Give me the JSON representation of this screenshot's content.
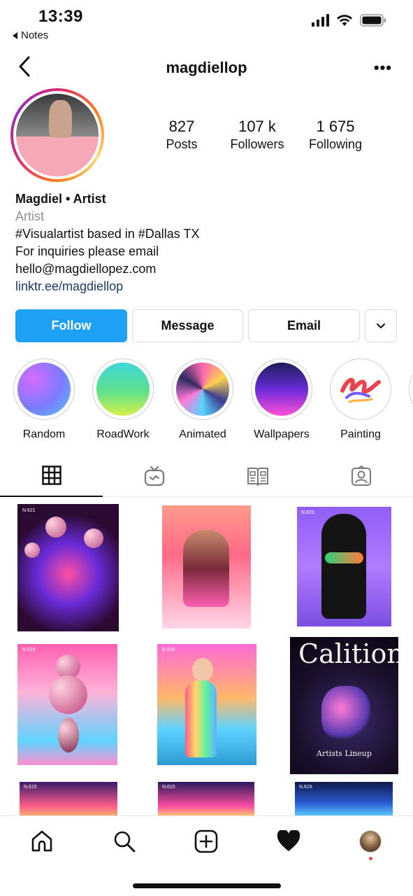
{
  "status_bar": {
    "time": "13:39",
    "back_app": "Notes",
    "icons": [
      "cellular-signal-icon",
      "wifi-icon",
      "battery-icon"
    ]
  },
  "header": {
    "username": "magdiellop",
    "back_icon": "chevron-left-icon",
    "more_icon": "more-horizontal-icon",
    "more_glyph": "•••"
  },
  "profile": {
    "stats": [
      {
        "value": "827",
        "label": "Posts"
      },
      {
        "value": "107 k",
        "label": "Followers"
      },
      {
        "value": "1 675",
        "label": "Following"
      }
    ],
    "bio": {
      "name": "Magdiel • Artist",
      "category": "Artist",
      "lines": [
        "#Visualartist based in #Dallas TX",
        "For inquiries please email",
        "hello@magdiellopez.com"
      ],
      "link": "linktr.ee/magdiellop"
    }
  },
  "actions": {
    "follow": "Follow",
    "message": "Message",
    "email": "Email",
    "dropdown_icon": "chevron-down-icon"
  },
  "highlights": [
    {
      "label": "Random"
    },
    {
      "label": "RoadWork"
    },
    {
      "label": "Animated"
    },
    {
      "label": "Wallpapers"
    },
    {
      "label": "Painting"
    }
  ],
  "tabs": [
    {
      "icon": "grid-icon",
      "active": true
    },
    {
      "icon": "igtv-icon",
      "active": false
    },
    {
      "icon": "guide-icon",
      "active": false
    },
    {
      "icon": "tagged-icon",
      "active": false
    }
  ],
  "posts": [
    {
      "tag": "N.621"
    },
    {
      "tag": ""
    },
    {
      "tag": "N.620"
    },
    {
      "tag": "N.619"
    },
    {
      "tag": "N.618"
    },
    {
      "tag": "",
      "title": "Calition",
      "subtitle": "Artists Lineup"
    },
    {
      "tag": "N.615"
    },
    {
      "tag": "N.615"
    },
    {
      "tag": "N.615"
    }
  ],
  "bottom_nav": [
    {
      "icon": "home-icon"
    },
    {
      "icon": "search-icon"
    },
    {
      "icon": "new-post-icon"
    },
    {
      "icon": "activity-heart-icon"
    },
    {
      "icon": "profile-avatar-icon"
    }
  ],
  "colors": {
    "follow_button": "#1da1f5",
    "link": "#1d3a6a",
    "category": "#8e8e8e"
  }
}
